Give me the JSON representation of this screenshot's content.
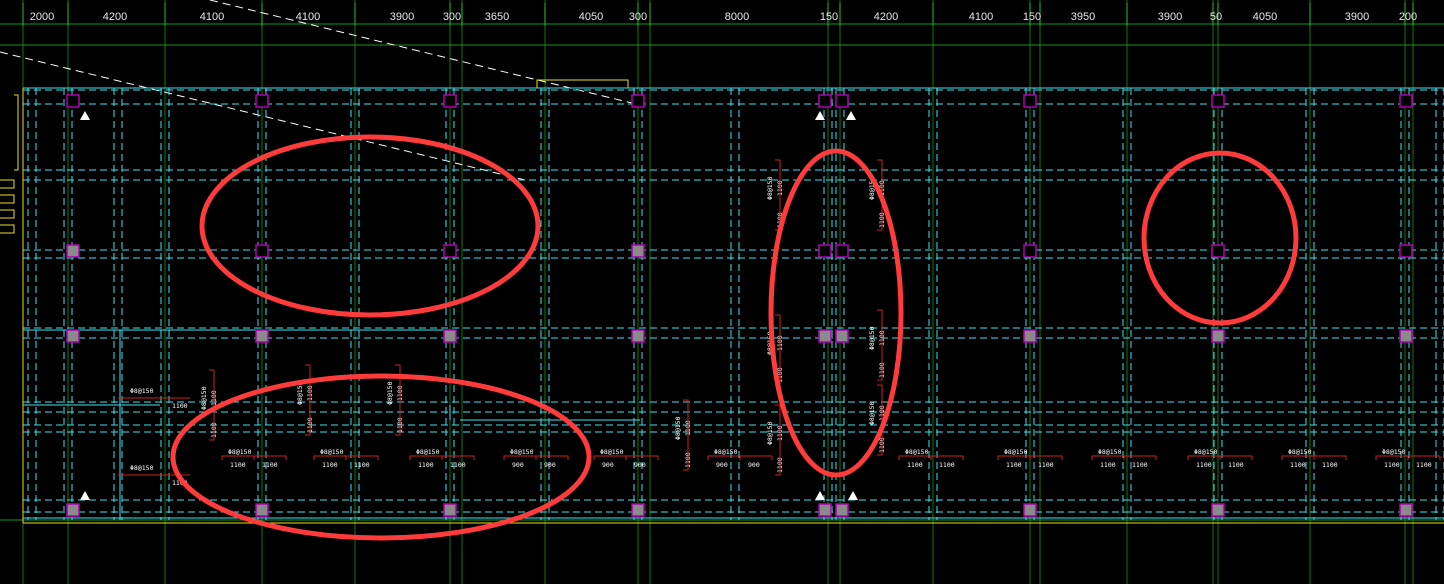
{
  "top_dimensions": [
    "2000",
    "4200",
    "4100",
    "4100",
    "3900",
    "300",
    "3650",
    "4050",
    "300",
    "8000",
    "150",
    "4200",
    "4100",
    "150",
    "3950",
    "3900",
    "50",
    "4050",
    "3900",
    "200"
  ],
  "rebar_labels": {
    "spec": "Φ8@150",
    "spec_alt": "Φ8@150",
    "len_1100": "1100",
    "len_900": "900"
  },
  "colors": {
    "background": "#000000",
    "grid_cyan": "#3fe0f0",
    "axis_green": "#22c422",
    "column_magenta": "#b000b0",
    "column_fill": "#8a8a8a",
    "annotation_red": "#ff3b3b",
    "leader_red": "#d02020",
    "outline_yellow": "#e8e020",
    "white": "#ffffff"
  },
  "icons": [
    "triangle-marker-icon"
  ]
}
